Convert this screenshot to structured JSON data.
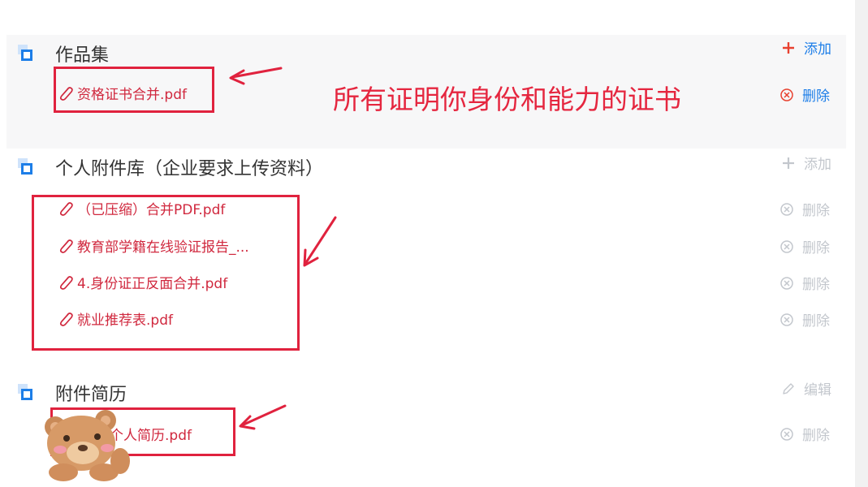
{
  "sections": [
    {
      "title": "作品集",
      "files": [
        "资格证书合并.pdf"
      ],
      "header_action": {
        "label": "添加",
        "icon": "plus-icon",
        "state": "active"
      },
      "file_action": {
        "label": "删除",
        "icon": "circle-x-icon",
        "state": "active"
      }
    },
    {
      "title": "个人附件库（企业要求上传资料）",
      "files": [
        "（已压缩）合并PDF.pdf",
        "教育部学籍在线验证报告_...",
        "4.身份证正反面合并.pdf",
        "就业推荐表.pdf"
      ],
      "header_action": {
        "label": "添加",
        "icon": "plus-icon",
        "state": "disabled"
      },
      "file_action": {
        "label": "删除",
        "icon": "circle-x-icon",
        "state": "disabled"
      }
    },
    {
      "title": "附件简历",
      "files": [
        "个人简历.pdf"
      ],
      "header_action": {
        "label": "编辑",
        "icon": "pencil-icon",
        "state": "disabled"
      },
      "file_action": {
        "label": "删除",
        "icon": "circle-x-icon",
        "state": "disabled"
      }
    }
  ],
  "annotation": {
    "text": "所有证明你身份和能力的证书",
    "color": "#e5263f"
  },
  "colors": {
    "accent_blue": "#1d7ee8",
    "file_red": "#d0283e",
    "disabled_gray": "#c3c7cd",
    "plus_red": "#e8412f",
    "annotation_red": "#e0223e"
  }
}
